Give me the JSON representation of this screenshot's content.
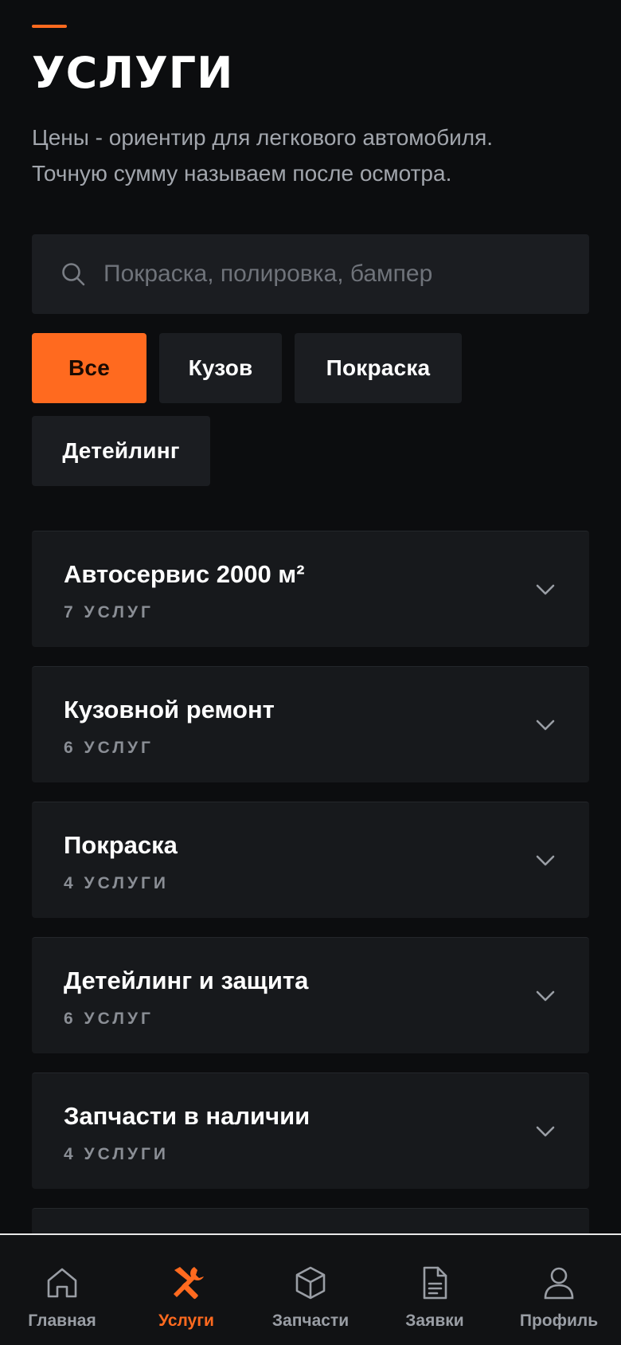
{
  "header": {
    "title": "УСЛУГИ",
    "subtitle_line1": "Цены - ориентир для легкового автомобиля.",
    "subtitle_line2": "Точную сумму называем после осмотра."
  },
  "search": {
    "placeholder": "Покраска, полировка, бампер",
    "value": "",
    "icon": "search-icon"
  },
  "filters": [
    {
      "label": "Все",
      "active": true
    },
    {
      "label": "Кузов",
      "active": false
    },
    {
      "label": "Покраска",
      "active": false
    },
    {
      "label": "Детейлинг",
      "active": false
    }
  ],
  "categories": [
    {
      "title": "Автосервис 2000 м²",
      "count": "7 УСЛУГ"
    },
    {
      "title": "Кузовной ремонт",
      "count": "6 УСЛУГ"
    },
    {
      "title": "Покраска",
      "count": "4 УСЛУГИ"
    },
    {
      "title": "Детейлинг и защита",
      "count": "6 УСЛУГ"
    },
    {
      "title": "Запчасти в наличии",
      "count": "4 УСЛУГИ"
    }
  ],
  "bottom_nav": [
    {
      "label": "Главная",
      "icon": "home-icon",
      "active": false
    },
    {
      "label": "Услуги",
      "icon": "tools-icon",
      "active": true
    },
    {
      "label": "Запчасти",
      "icon": "box-icon",
      "active": false
    },
    {
      "label": "Заявки",
      "icon": "document-icon",
      "active": false
    },
    {
      "label": "Профиль",
      "icon": "user-icon",
      "active": false
    }
  ],
  "colors": {
    "background": "#0c0d0f",
    "card": "#17191c",
    "accent": "#ff6a1f",
    "text_muted": "#a2a6ad"
  }
}
